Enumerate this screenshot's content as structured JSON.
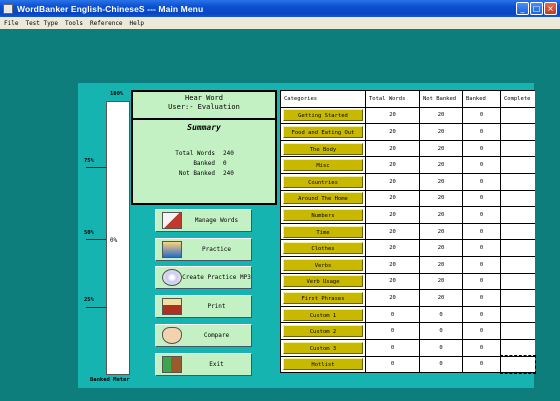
{
  "window": {
    "title": "WordBanker English-ChineseS --- Main Menu",
    "buttons": [
      "_",
      "□",
      "×"
    ]
  },
  "menu": [
    "File",
    "Test Type",
    "Tools",
    "Reference",
    "Help"
  ],
  "meter": {
    "top_label": "100%",
    "ticks": [
      "75%",
      "50%",
      "25%"
    ],
    "percent": "0%",
    "fill_fraction": 0,
    "caption": "Banked Meter"
  },
  "info": {
    "hear_word": "Hear Word",
    "user": "User:- Evaluation",
    "summary": "Summary",
    "stats": [
      {
        "label": "Total Words",
        "value": "240"
      },
      {
        "label": "Banked",
        "value": "0"
      },
      {
        "label": "Not Banked",
        "value": "240"
      }
    ]
  },
  "actions": [
    {
      "label": "Manage Words",
      "icon": "manage-words-icon"
    },
    {
      "label": "Practice",
      "icon": "practice-icon"
    },
    {
      "label": "Create Practice MP3",
      "icon": "cd-icon"
    },
    {
      "label": "Print",
      "icon": "printer-icon"
    },
    {
      "label": "Compare",
      "icon": "ear-icon"
    },
    {
      "label": "Exit",
      "icon": "exit-door-icon"
    }
  ],
  "table": {
    "headers": [
      "Categories",
      "Total Words",
      "Not Banked",
      "Banked",
      "Complete"
    ],
    "rows": [
      [
        "Getting Started",
        "20",
        "20",
        "0",
        ""
      ],
      [
        "Food and Eating Out",
        "20",
        "20",
        "0",
        ""
      ],
      [
        "The Body",
        "20",
        "20",
        "0",
        ""
      ],
      [
        "Misc",
        "20",
        "20",
        "0",
        ""
      ],
      [
        "Countries",
        "20",
        "20",
        "0",
        ""
      ],
      [
        "Around The Home",
        "20",
        "20",
        "0",
        ""
      ],
      [
        "Numbers",
        "20",
        "20",
        "0",
        ""
      ],
      [
        "Time",
        "20",
        "20",
        "0",
        ""
      ],
      [
        "Clothes",
        "20",
        "20",
        "0",
        ""
      ],
      [
        "Verbs",
        "20",
        "20",
        "0",
        ""
      ],
      [
        "Verb Usage",
        "20",
        "20",
        "0",
        ""
      ],
      [
        "First Phrases",
        "20",
        "20",
        "0",
        ""
      ],
      [
        "Custom 1",
        "0",
        "0",
        "0",
        ""
      ],
      [
        "Custom 2",
        "0",
        "0",
        "0",
        ""
      ],
      [
        "Custom 3",
        "0",
        "0",
        "0",
        ""
      ],
      [
        "Hotlist",
        "0",
        "0",
        "0",
        ""
      ]
    ]
  }
}
